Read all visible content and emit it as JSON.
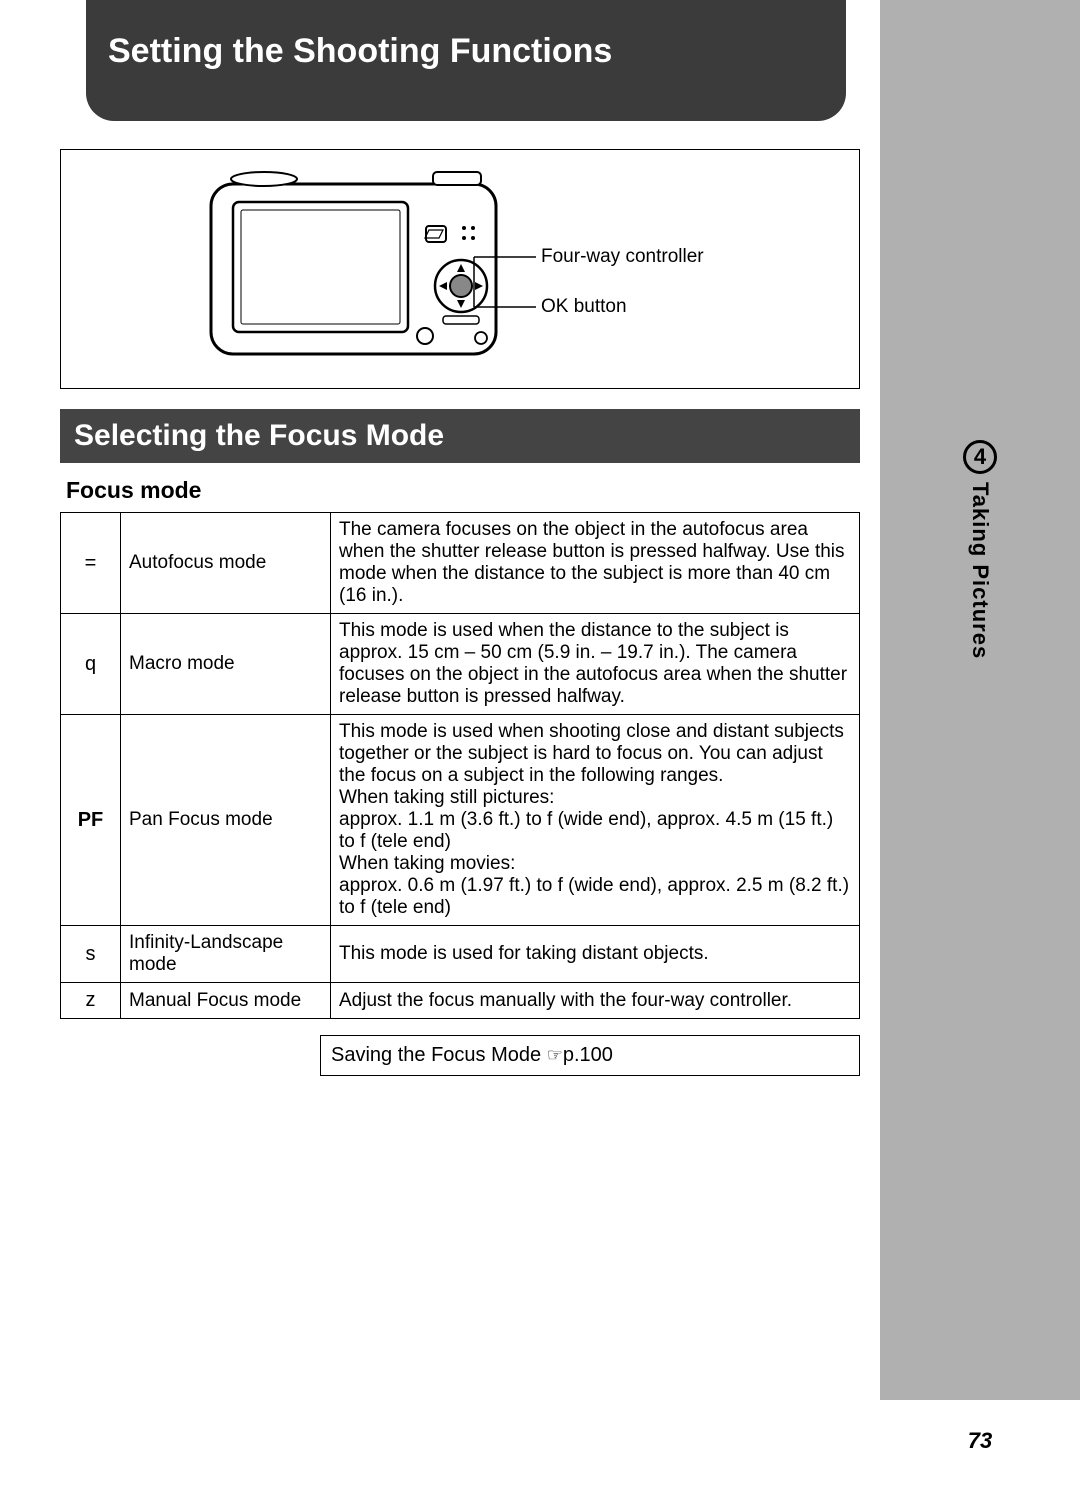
{
  "page_number": "73",
  "chapter": {
    "number": "4",
    "label": "Taking Pictures"
  },
  "title": "Setting the Shooting Functions",
  "diagram": {
    "callout_four_way": "Four-way controller",
    "callout_ok": "OK button"
  },
  "section_heading": "Selecting the Focus Mode",
  "table_caption": "Focus mode",
  "modes": [
    {
      "symbol": "=",
      "name": "Autofocus mode",
      "desc": "The camera focuses on the object in the autofocus area when the shutter release button is pressed halfway. Use this mode when the distance to the subject is more than 40 cm (16 in.)."
    },
    {
      "symbol": "q",
      "name": "Macro mode",
      "desc": "This mode is used when the distance to the subject is approx. 15 cm – 50 cm (5.9 in. – 19.7 in.). The camera focuses on the object in the autofocus area when the shutter release button is pressed halfway."
    },
    {
      "symbol": "PF",
      "name": "Pan Focus mode",
      "desc": "This mode is used when shooting close and distant subjects together or the subject is hard to focus on. You can adjust the focus on a subject in the following ranges.\nWhen taking still pictures:\napprox. 1.1 m (3.6 ft.) to  f  (wide end), approx. 4.5 m (15 ft.) to  f  (tele end)\nWhen taking movies:\napprox. 0.6 m (1.97 ft.) to  f  (wide end), approx. 2.5 m (8.2 ft.) to  f  (tele end)"
    },
    {
      "symbol": "s",
      "name": "Infinity-Landscape mode",
      "desc": "This mode is used for taking distant objects."
    },
    {
      "symbol": "z",
      "name": "Manual Focus mode",
      "desc": "Adjust the focus manually with the four-way controller."
    }
  ],
  "reference": {
    "text": "Saving the Focus Mode ",
    "icon": "☞",
    "page": "p.100"
  }
}
